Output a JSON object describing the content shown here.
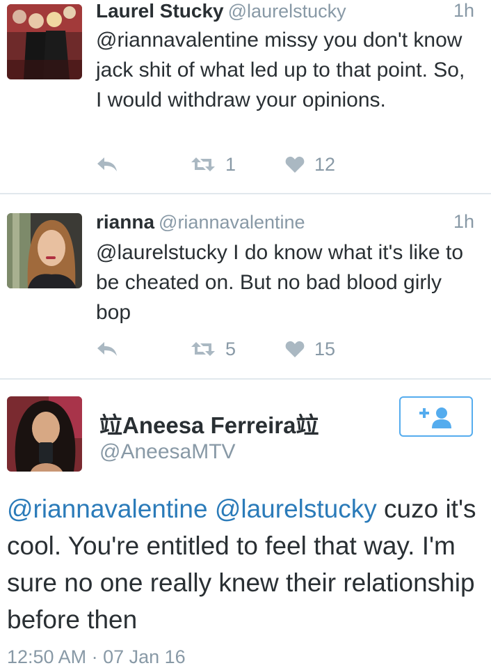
{
  "colors": {
    "text": "#292f33",
    "muted": "#8899a6",
    "link": "#2b7bb9",
    "divider": "#e1e8ed",
    "follow_accent": "#55acee",
    "action_icon": "#aab8c2"
  },
  "tweets": [
    {
      "name": "Laurel Stucky",
      "handle": "@laurelstucky",
      "time": "1h",
      "text": "@riannavalentine missy you don't know jack shit of what led up to that point. So, I would withdraw your opinions.",
      "retweets": "1",
      "likes": "12",
      "icons": {
        "reply": "reply-icon",
        "retweet": "retweet-icon",
        "like": "heart-icon"
      }
    },
    {
      "name": "rianna",
      "handle": "@riannavalentine",
      "time": "1h",
      "text": "@laurelstucky I do know what it's like to be cheated on. But no bad blood girly bop",
      "retweets": "5",
      "likes": "15",
      "icons": {
        "reply": "reply-icon",
        "retweet": "retweet-icon",
        "like": "heart-icon"
      }
    }
  ],
  "focused_tweet": {
    "name": "竝Aneesa Ferreira竝",
    "handle": "@AneesaMTV",
    "mention_1": "@riannavalentine",
    "mention_2": "@laurelstucky",
    "text": " cuzo it's cool. You're entitled to feel that way. I'm sure no one really knew their relationship before then",
    "timestamp": "12:50 AM · 07 Jan 16",
    "follow_icon": "follow-person-plus-icon"
  }
}
